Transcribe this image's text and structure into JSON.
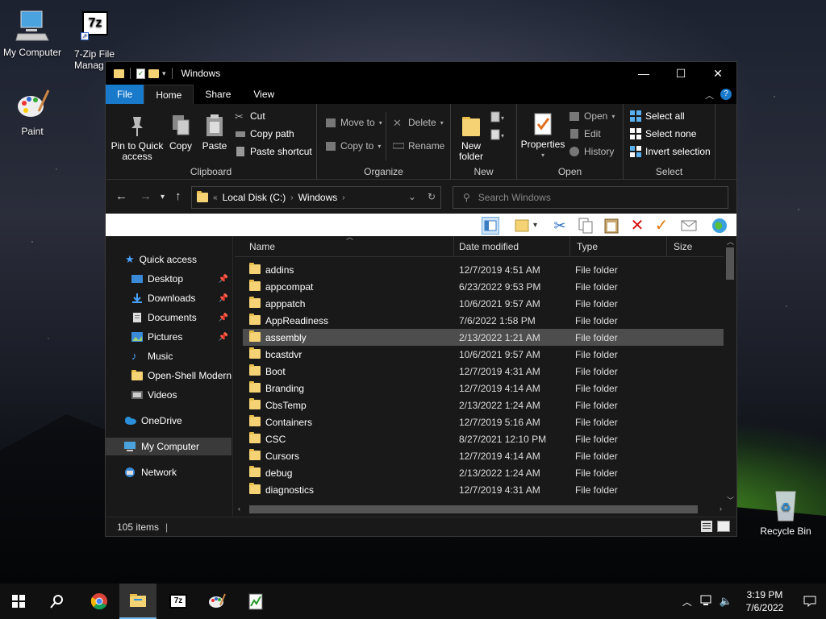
{
  "desktop": {
    "icons": [
      {
        "label": "My Computer"
      },
      {
        "label": "7-Zip File Manag",
        "glyph": "7z"
      },
      {
        "label": "Paint"
      },
      {
        "label": "Recycle Bin"
      }
    ]
  },
  "window": {
    "title": "Windows",
    "tabs": [
      "File",
      "Home",
      "Share",
      "View"
    ],
    "active_tab": "Home"
  },
  "ribbon": {
    "clipboard": {
      "name": "Clipboard",
      "pin_label_1": "Pin to Quick",
      "pin_label_2": "access",
      "copy": "Copy",
      "paste": "Paste",
      "cut": "Cut",
      "copy_path": "Copy path",
      "paste_shortcut": "Paste shortcut"
    },
    "organize": {
      "name": "Organize",
      "move_to": "Move to",
      "copy_to": "Copy to",
      "delete": "Delete",
      "rename": "Rename"
    },
    "new": {
      "name": "New",
      "new_folder_1": "New",
      "new_folder_2": "folder"
    },
    "open": {
      "name": "Open",
      "properties": "Properties",
      "open": "Open",
      "edit": "Edit",
      "history": "History"
    },
    "select": {
      "name": "Select",
      "select_all": "Select all",
      "select_none": "Select none",
      "invert": "Invert selection"
    }
  },
  "address": {
    "prefix": "«",
    "crumbs": [
      "Local Disk (C:)",
      "Windows"
    ],
    "search_placeholder": "Search Windows"
  },
  "nav": {
    "quick_access": "Quick access",
    "items": [
      {
        "label": "Desktop",
        "pinned": true
      },
      {
        "label": "Downloads",
        "pinned": true
      },
      {
        "label": "Documents",
        "pinned": true
      },
      {
        "label": "Pictures",
        "pinned": true
      },
      {
        "label": "Music",
        "pinned": false
      },
      {
        "label": "Open-Shell Modern",
        "pinned": false
      },
      {
        "label": "Videos",
        "pinned": false
      }
    ],
    "onedrive": "OneDrive",
    "my_computer": "My Computer",
    "network": "Network"
  },
  "columns": {
    "name": "Name",
    "date": "Date modified",
    "type": "Type",
    "size": "Size"
  },
  "files": [
    {
      "name": "addins",
      "date": "12/7/2019 4:51 AM",
      "type": "File folder"
    },
    {
      "name": "appcompat",
      "date": "6/23/2022 9:53 PM",
      "type": "File folder"
    },
    {
      "name": "apppatch",
      "date": "10/6/2021 9:57 AM",
      "type": "File folder"
    },
    {
      "name": "AppReadiness",
      "date": "7/6/2022 1:58 PM",
      "type": "File folder"
    },
    {
      "name": "assembly",
      "date": "2/13/2022 1:21 AM",
      "type": "File folder",
      "highlighted": true
    },
    {
      "name": "bcastdvr",
      "date": "10/6/2021 9:57 AM",
      "type": "File folder"
    },
    {
      "name": "Boot",
      "date": "12/7/2019 4:31 AM",
      "type": "File folder"
    },
    {
      "name": "Branding",
      "date": "12/7/2019 4:14 AM",
      "type": "File folder"
    },
    {
      "name": "CbsTemp",
      "date": "2/13/2022 1:24 AM",
      "type": "File folder"
    },
    {
      "name": "Containers",
      "date": "12/7/2019 5:16 AM",
      "type": "File folder"
    },
    {
      "name": "CSC",
      "date": "8/27/2021 12:10 PM",
      "type": "File folder"
    },
    {
      "name": "Cursors",
      "date": "12/7/2019 4:14 AM",
      "type": "File folder"
    },
    {
      "name": "debug",
      "date": "2/13/2022 1:24 AM",
      "type": "File folder"
    },
    {
      "name": "diagnostics",
      "date": "12/7/2019 4:31 AM",
      "type": "File folder"
    }
  ],
  "status": {
    "count": "105 items"
  },
  "taskbar": {
    "time": "3:19 PM",
    "date": "7/6/2022",
    "sevenzip": "7z"
  },
  "colors": {
    "file_tab": "#1979ca",
    "folder": "#f5d273",
    "highlight_row": "#4d4d4d"
  }
}
